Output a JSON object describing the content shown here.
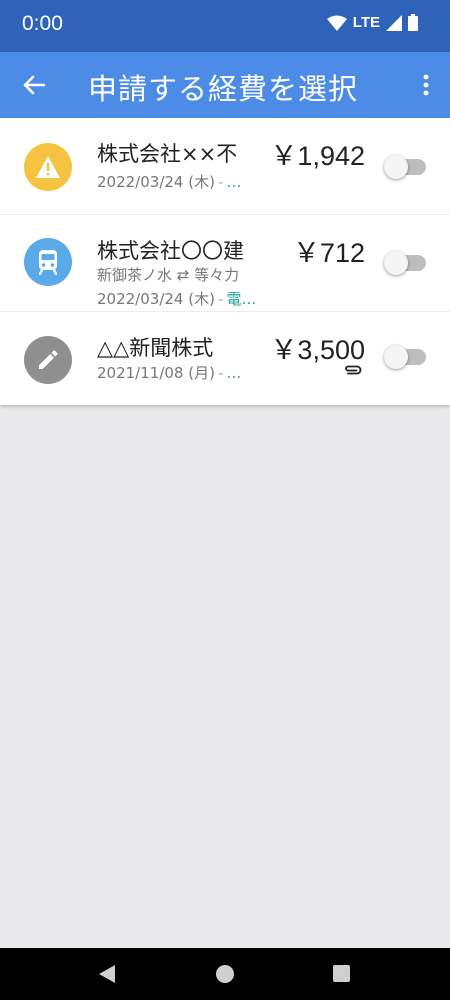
{
  "status": {
    "time": "0:00",
    "network": "LTE"
  },
  "app_bar": {
    "title": "申請する経費を選択",
    "back_icon": "arrow-left-icon",
    "more_icon": "more-vert-icon"
  },
  "colors": {
    "status_bar": "#2f63b9",
    "app_bar": "#4d8ce6",
    "warning": "#f5c242",
    "train": "#5aa9e9",
    "memo": "#8f8f8f",
    "accent": "#26a69a"
  },
  "items": [
    {
      "icon": "warning-icon",
      "name": "株式会社××不",
      "amount": "￥1,942",
      "date": "2022/03/24 (木)",
      "tag": "…",
      "enabled": false
    },
    {
      "icon": "train-icon",
      "name": "株式会社〇〇建",
      "amount": "￥712",
      "route": "新御茶ノ水 ⇄ 等々力",
      "date": "2022/03/24 (木)",
      "tag": "電…",
      "enabled": false
    },
    {
      "icon": "pencil-icon",
      "name": "△△新聞株式",
      "amount": "￥3,500",
      "date": "2021/11/08 (月)",
      "tag": "…",
      "has_attachment": true,
      "enabled": false
    }
  ]
}
